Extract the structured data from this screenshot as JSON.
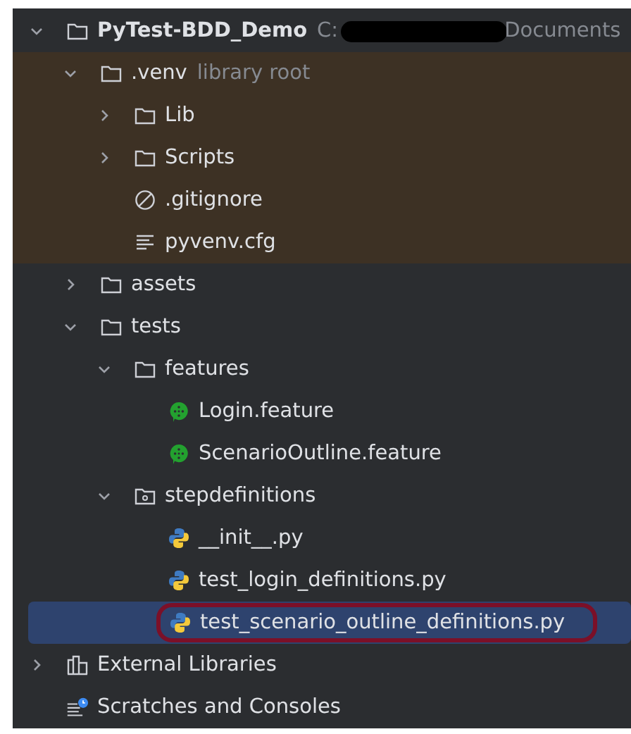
{
  "project_tree": {
    "items": [
      {
        "name": "PyTest-BDD_Demo",
        "kind": "project",
        "expanded": true,
        "selected": false,
        "path_start": "C:",
        "path_end": "Documents",
        "children": [
          {
            "name": ".venv",
            "kind": "folder",
            "expanded": true,
            "selected": false,
            "library_root": true,
            "hint": "library root",
            "children": [
              {
                "name": "Lib",
                "kind": "folder",
                "expanded": false,
                "selected": false
              },
              {
                "name": "Scripts",
                "kind": "folder",
                "expanded": false,
                "selected": false
              },
              {
                "name": ".gitignore",
                "kind": "ignore",
                "selected": false
              },
              {
                "name": "pyvenv.cfg",
                "kind": "text",
                "selected": false
              }
            ]
          },
          {
            "name": "assets",
            "kind": "folder",
            "expanded": false,
            "selected": false
          },
          {
            "name": "tests",
            "kind": "folder",
            "expanded": true,
            "selected": false,
            "children": [
              {
                "name": "features",
                "kind": "folder",
                "expanded": true,
                "selected": false,
                "children": [
                  {
                    "name": "Login.feature",
                    "kind": "feature",
                    "selected": false
                  },
                  {
                    "name": "ScenarioOutline.feature",
                    "kind": "feature",
                    "selected": false
                  }
                ]
              },
              {
                "name": "stepdefinitions",
                "kind": "package",
                "expanded": true,
                "selected": false,
                "children": [
                  {
                    "name": "__init__.py",
                    "kind": "python",
                    "selected": false
                  },
                  {
                    "name": "test_login_definitions.py",
                    "kind": "python",
                    "selected": false
                  },
                  {
                    "name": "test_scenario_outline_definitions.py",
                    "kind": "python",
                    "selected": true,
                    "annotated": true
                  }
                ]
              }
            ]
          }
        ]
      },
      {
        "name": "External Libraries",
        "kind": "libraries",
        "expanded": false,
        "selected": false
      },
      {
        "name": "Scratches and Consoles",
        "kind": "scratches",
        "selected": false
      }
    ]
  }
}
